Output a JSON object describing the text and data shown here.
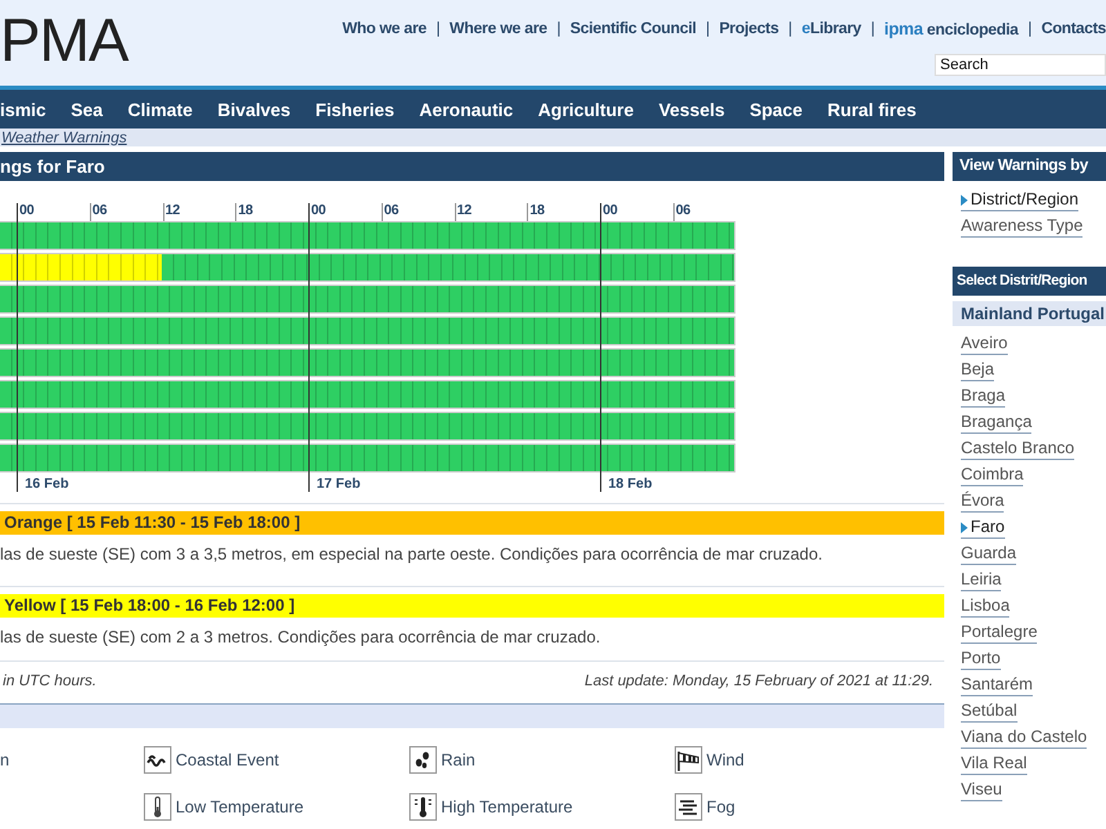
{
  "header": {
    "logo": "PMA",
    "separator": "|",
    "links": [
      {
        "label": "Who we are"
      },
      {
        "label": "Where we are"
      },
      {
        "label": "Scientific Council"
      },
      {
        "label": "Projects"
      },
      {
        "accent": "e",
        "label": "Library"
      },
      {
        "accent": "ipma",
        "label": " enciclopedia"
      },
      {
        "label": "Contacts"
      }
    ],
    "search": {
      "placeholder": "Search"
    }
  },
  "nav": [
    {
      "label": "ismic"
    },
    {
      "label": "Sea"
    },
    {
      "label": "Climate"
    },
    {
      "label": "Bivalves"
    },
    {
      "label": "Fisheries"
    },
    {
      "label": "Aeronautic"
    },
    {
      "label": "Agriculture"
    },
    {
      "label": "Vessels"
    },
    {
      "label": "Space"
    },
    {
      "label": "Rural fires"
    }
  ],
  "breadcrumb": "Weather Warnings",
  "main": {
    "title": "ngs for Faro",
    "timeline": {
      "hours": [
        "00",
        "06",
        "12",
        "18",
        "00",
        "06",
        "12",
        "18",
        "00",
        "06"
      ],
      "days": [
        "16 Feb",
        "17 Feb",
        "18 Feb"
      ],
      "rows": [
        {
          "segments": [
            {
              "color": "#2ecf63",
              "level": 1
            }
          ]
        },
        {
          "segments": [
            {
              "color": "#ffff00",
              "level": 0.22
            },
            {
              "color": "#2ecf63",
              "level": 0.78
            }
          ]
        },
        {
          "segments": [
            {
              "color": "#2ecf63",
              "level": 1
            }
          ]
        },
        {
          "segments": [
            {
              "color": "#2ecf63",
              "level": 1
            }
          ]
        },
        {
          "segments": [
            {
              "color": "#2ecf63",
              "level": 1
            }
          ]
        },
        {
          "segments": [
            {
              "color": "#2ecf63",
              "level": 1
            }
          ]
        },
        {
          "segments": [
            {
              "color": "#2ecf63",
              "level": 1
            }
          ]
        },
        {
          "segments": [
            {
              "color": "#2ecf63",
              "level": 1
            }
          ]
        }
      ]
    },
    "warnings": [
      {
        "color": "#ffc000",
        "title": "Orange [ 15 Feb 11:30 - 15 Feb 18:00 ]",
        "text": "las de sueste (SE) com 3 a 3,5 metros, em especial na parte oeste. Condições para ocorrência de mar cruzado."
      },
      {
        "color": "#ffff00",
        "title": "Yellow [ 15 Feb 18:00 - 16 Feb 12:00 ]",
        "text": "las de sueste (SE) com 2 a 3 metros. Condições para ocorrência de mar cruzado."
      }
    ],
    "note": "in UTC hours.",
    "last_update": "Last update: Monday, 15 February of 2021 at 11:29.",
    "legend": [
      [
        {
          "label": "n"
        },
        {
          "kind": "coastal",
          "label": "Coastal Event"
        },
        {
          "kind": "rain",
          "label": "Rain"
        },
        {
          "kind": "wind",
          "label": "Wind"
        }
      ],
      [
        {
          "kind": "cold",
          "label": "Low Temperature"
        },
        {
          "kind": "heat",
          "label": "High Temperature"
        },
        {
          "kind": "fog",
          "label": "Fog"
        }
      ]
    ]
  },
  "sidebar": {
    "view_title": "View Warnings by",
    "view_options": [
      {
        "label": "District/Region",
        "selected": true
      },
      {
        "label": "Awareness Type",
        "selected": false
      }
    ],
    "select_title": "Select Distrit/Region",
    "group": "Mainland Portugal",
    "districts": [
      {
        "label": "Aveiro",
        "selected": false
      },
      {
        "label": "Beja",
        "selected": false
      },
      {
        "label": "Braga",
        "selected": false
      },
      {
        "label": "Bragança",
        "selected": false
      },
      {
        "label": "Castelo Branco",
        "selected": false
      },
      {
        "label": "Coimbra",
        "selected": false
      },
      {
        "label": "Évora",
        "selected": false
      },
      {
        "label": "Faro",
        "selected": true
      },
      {
        "label": "Guarda",
        "selected": false
      },
      {
        "label": "Leiria",
        "selected": false
      },
      {
        "label": "Lisboa",
        "selected": false
      },
      {
        "label": "Portalegre",
        "selected": false
      },
      {
        "label": "Porto",
        "selected": false
      },
      {
        "label": "Santarém",
        "selected": false
      },
      {
        "label": "Setúbal",
        "selected": false
      },
      {
        "label": "Viana do Castelo",
        "selected": false
      },
      {
        "label": "Vila Real",
        "selected": false
      },
      {
        "label": "Viseu",
        "selected": false
      }
    ]
  }
}
